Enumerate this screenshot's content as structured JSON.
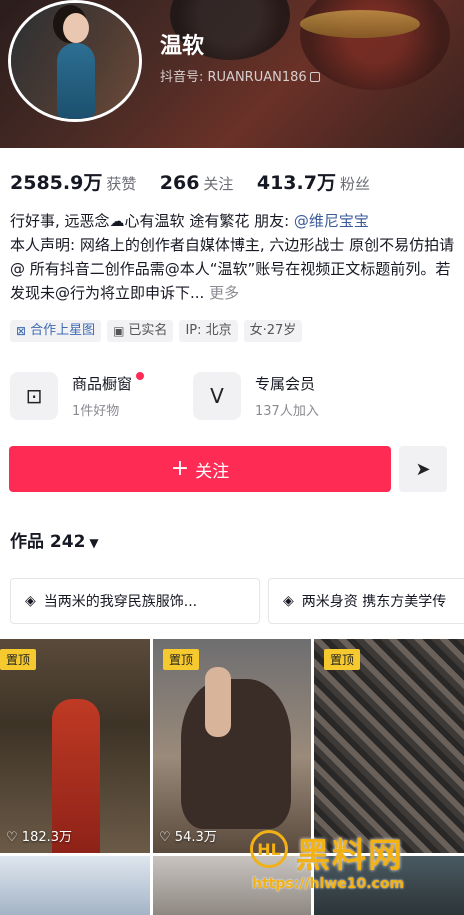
{
  "profile": {
    "name": "温软",
    "douyin_id": "抖音号: RUANRUAN186"
  },
  "stats": [
    {
      "value": "2585.9万",
      "label": "获赞"
    },
    {
      "value": "266",
      "label": "关注"
    },
    {
      "value": "413.7万",
      "label": "粉丝"
    }
  ],
  "bio": {
    "line1_a": "行好事, 远恶念",
    "line1_b": "心有温软 途有繁花 朋友: ",
    "mention": "@维尼宝宝",
    "rest": "本人声明: 网络上的创作者自媒体博主, 六边形战士 原创不易仿拍请@ 所有抖音二创作品需@本人“温软”账号在视频正文标题前列。若发现未@行为将立即申诉下...",
    "more": "更多"
  },
  "tags": [
    {
      "icon": "star-map-icon",
      "label": "合作上星图"
    },
    {
      "icon": "id-card-icon",
      "label": "已实名"
    },
    {
      "icon": "",
      "label": "IP: 北京"
    },
    {
      "icon": "",
      "label": "女·27岁"
    }
  ],
  "shop": {
    "title": "商品橱窗",
    "sub": "1件好物",
    "icon": "shop-icon"
  },
  "member": {
    "title": "专属会员",
    "sub": "137人加入",
    "icon": "vip-icon"
  },
  "actions": {
    "follow_label": "关注",
    "share_icon": "share-arrow-icon"
  },
  "works": {
    "label": "作品 242"
  },
  "collections": [
    {
      "label": "当两米的我穿民族服饰..."
    },
    {
      "label": "两米身资 携东方美学传"
    }
  ],
  "videos": [
    {
      "pinned": "置顶",
      "likes": "182.3万"
    },
    {
      "pinned": "置顶",
      "likes": "54.3万"
    },
    {
      "pinned": "置顶",
      "likes": ""
    }
  ],
  "watermark": {
    "brand": "黑料网",
    "url": "https://hlwe10.com",
    "logo_text": "HL"
  },
  "colors": {
    "accent": "#fe2c55",
    "pin": "#f6c92f",
    "mention": "#3a5a98"
  }
}
